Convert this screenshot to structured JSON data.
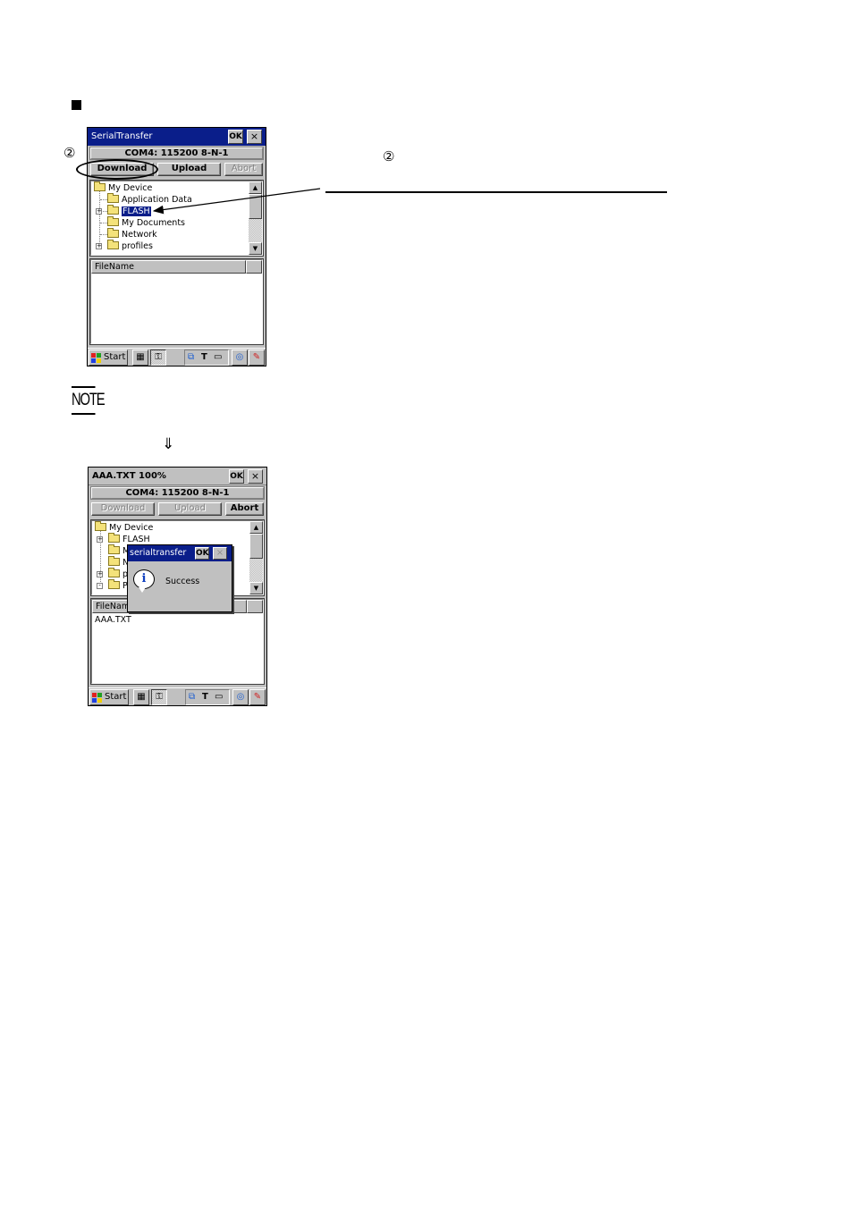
{
  "page": {
    "callout_marker": "②",
    "down_arrow": "⇓",
    "note_label": "NOTE"
  },
  "screen1": {
    "title": "SerialTransfer",
    "ok_label": "OK",
    "close_label": "×",
    "com_status": "COM4: 115200 8-N-1",
    "buttons": {
      "download": "Download",
      "upload": "Upload",
      "abort": "Abort"
    },
    "button_states": {
      "download": "enabled",
      "upload": "enabled",
      "abort": "disabled"
    },
    "tree": [
      {
        "label": "My Device",
        "level": 0,
        "expander": ""
      },
      {
        "label": "Application Data",
        "level": 1,
        "expander": ""
      },
      {
        "label": "FLASH",
        "level": 1,
        "expander": "+",
        "selected": true
      },
      {
        "label": "My Documents",
        "level": 1,
        "expander": ""
      },
      {
        "label": "Network",
        "level": 1,
        "expander": ""
      },
      {
        "label": "profiles",
        "level": 1,
        "expander": "+"
      }
    ],
    "file_list_header": "FileName",
    "files": [],
    "taskbar": {
      "start_label": "Start"
    }
  },
  "screen2": {
    "title": "AAA.TXT 100%",
    "ok_label": "OK",
    "close_label": "×",
    "com_status": "COM4: 115200 8-N-1",
    "buttons": {
      "download": "Download",
      "upload": "Upload",
      "abort": "Abort"
    },
    "button_states": {
      "download": "disabled",
      "upload": "disabled",
      "abort": "enabled"
    },
    "tree": [
      {
        "label": "My Device",
        "level": 0,
        "expander": ""
      },
      {
        "label": "FLASH",
        "level": 1,
        "expander": "+"
      },
      {
        "label": "M",
        "level": 1,
        "expander": ""
      },
      {
        "label": "N",
        "level": 1,
        "expander": ""
      },
      {
        "label": "p",
        "level": 1,
        "expander": "+"
      },
      {
        "label": "P",
        "level": 1,
        "expander": "-"
      }
    ],
    "file_list_header": "FileName",
    "files": [
      "AAA.TXT"
    ],
    "taskbar": {
      "start_label": "Start"
    },
    "dialog": {
      "title": "serialtransfer",
      "ok_label": "OK",
      "close_label": "×",
      "icon": "info-icon",
      "message": "Success"
    }
  }
}
